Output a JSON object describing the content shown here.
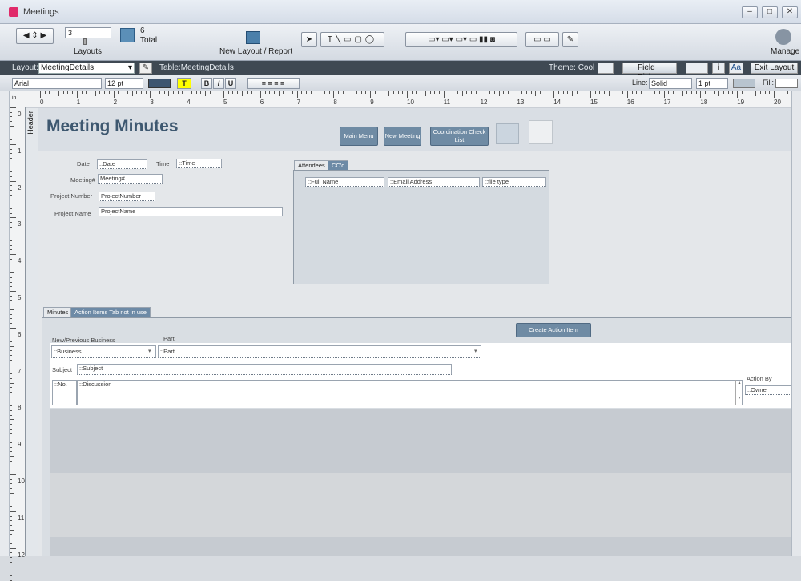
{
  "window": {
    "title": "Meetings"
  },
  "toolbar": {
    "record_value": "3",
    "layouts_label": "Layouts",
    "total_count": "6",
    "total_label": "Total",
    "new_layout_label": "New Layout / Report",
    "manage_label": "Manage"
  },
  "layoutbar": {
    "layout_label": "Layout:",
    "layout_value": "MeetingDetails",
    "table_label": "Table:",
    "table_value": "MeetingDetails",
    "theme_label": "Theme:",
    "theme_value": "Cool",
    "field_picker": "Field Picker",
    "exit_layout": "Exit Layout",
    "font_preview": "Aa"
  },
  "formatbar": {
    "font": "Arial",
    "size": "12 pt",
    "bold": "B",
    "italic": "I",
    "underline": "U",
    "highlight": "T",
    "line_label": "Line:",
    "line_style": "Solid",
    "line_width": "1 pt",
    "fill_label": "Fill:"
  },
  "ruler": {
    "unit": "in",
    "marks": [
      "0",
      "1",
      "2",
      "3",
      "4",
      "5",
      "6",
      "7",
      "8",
      "9",
      "10",
      "11",
      "12",
      "13",
      "14",
      "15",
      "16",
      "17",
      "18",
      "19",
      "20"
    ],
    "vmarks": [
      "0",
      "1",
      "2",
      "3",
      "4",
      "5",
      "6",
      "7",
      "8",
      "9",
      "10",
      "11",
      "12"
    ]
  },
  "parts": {
    "header": "Header"
  },
  "form": {
    "title": "Meeting Minutes",
    "buttons": {
      "main_menu": "Main Menu",
      "new_meeting": "New Meeting",
      "coord": "Coordination Check List",
      "create_action": "Create Action Item"
    },
    "labels": {
      "date": "Date",
      "time": "Time",
      "meeting_num": "Meeting#",
      "project_number": "Project Number",
      "project_name": "Project Name",
      "new_prev": "New/Previous Business",
      "part": "Part",
      "subject": "Subject",
      "action_by": "Action By"
    },
    "fields": {
      "date": "::Date",
      "time": "::Time",
      "meeting_num": "Meeting#",
      "project_number": "ProjectNumber",
      "project_name": "ProjectName",
      "business": "::Business",
      "part": "::Part",
      "subject": "::Subject",
      "no": "::No.",
      "discussion": "::Discussion",
      "owner": "::Owner",
      "full_name": "::Full Name",
      "email": "::Email Address",
      "file_type": "::file type"
    },
    "tabs_top": [
      "Attendees",
      "CC'd"
    ],
    "tabs_bottom": [
      "Minutes",
      "Action Items Tab not in use"
    ]
  }
}
